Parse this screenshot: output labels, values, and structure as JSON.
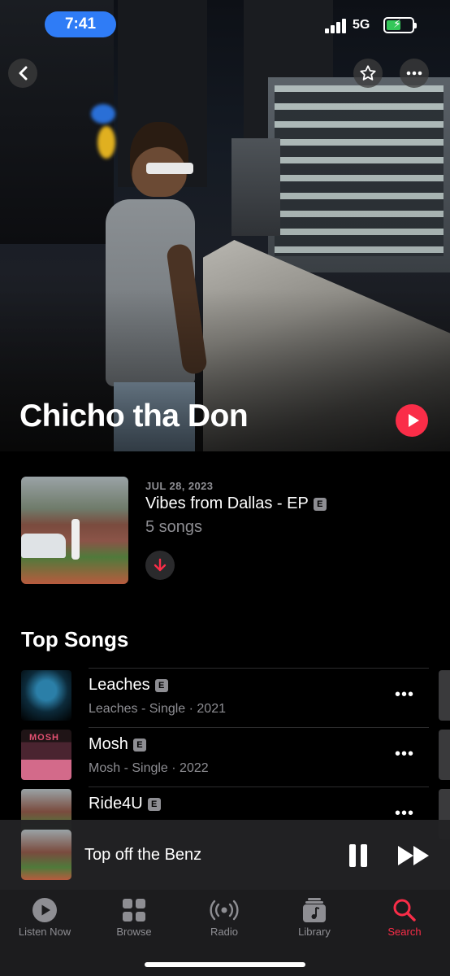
{
  "status_bar": {
    "time": "7:41",
    "network": "5G",
    "battery_color": "#34c759"
  },
  "header": {
    "artist_name": "Chicho tha Don"
  },
  "latest_release": {
    "date": "JUL 28, 2023",
    "title": "Vibes from Dallas - EP",
    "explicit_badge": "E",
    "song_count": "5 songs"
  },
  "top_songs": {
    "title": "Top Songs",
    "items": [
      {
        "name": "Leaches",
        "badge": "E",
        "meta": "Leaches - Single · 2021"
      },
      {
        "name": "Mosh",
        "badge": "E",
        "meta": "Mosh - Single · 2022",
        "art_text": "MOSH"
      },
      {
        "name": "Ride4U",
        "badge": "E",
        "meta": ""
      }
    ]
  },
  "now_playing": {
    "title": "Top off the Benz"
  },
  "tabs": [
    {
      "label": "Listen Now",
      "icon": "play-circle-icon"
    },
    {
      "label": "Browse",
      "icon": "grid-icon"
    },
    {
      "label": "Radio",
      "icon": "radio-waves-icon"
    },
    {
      "label": "Library",
      "icon": "music-library-icon"
    },
    {
      "label": "Search",
      "icon": "search-icon",
      "active": true
    }
  ],
  "colors": {
    "accent": "#fa2d48",
    "time_pill": "#2f7cf6",
    "secondary_text": "#8e8e93"
  }
}
